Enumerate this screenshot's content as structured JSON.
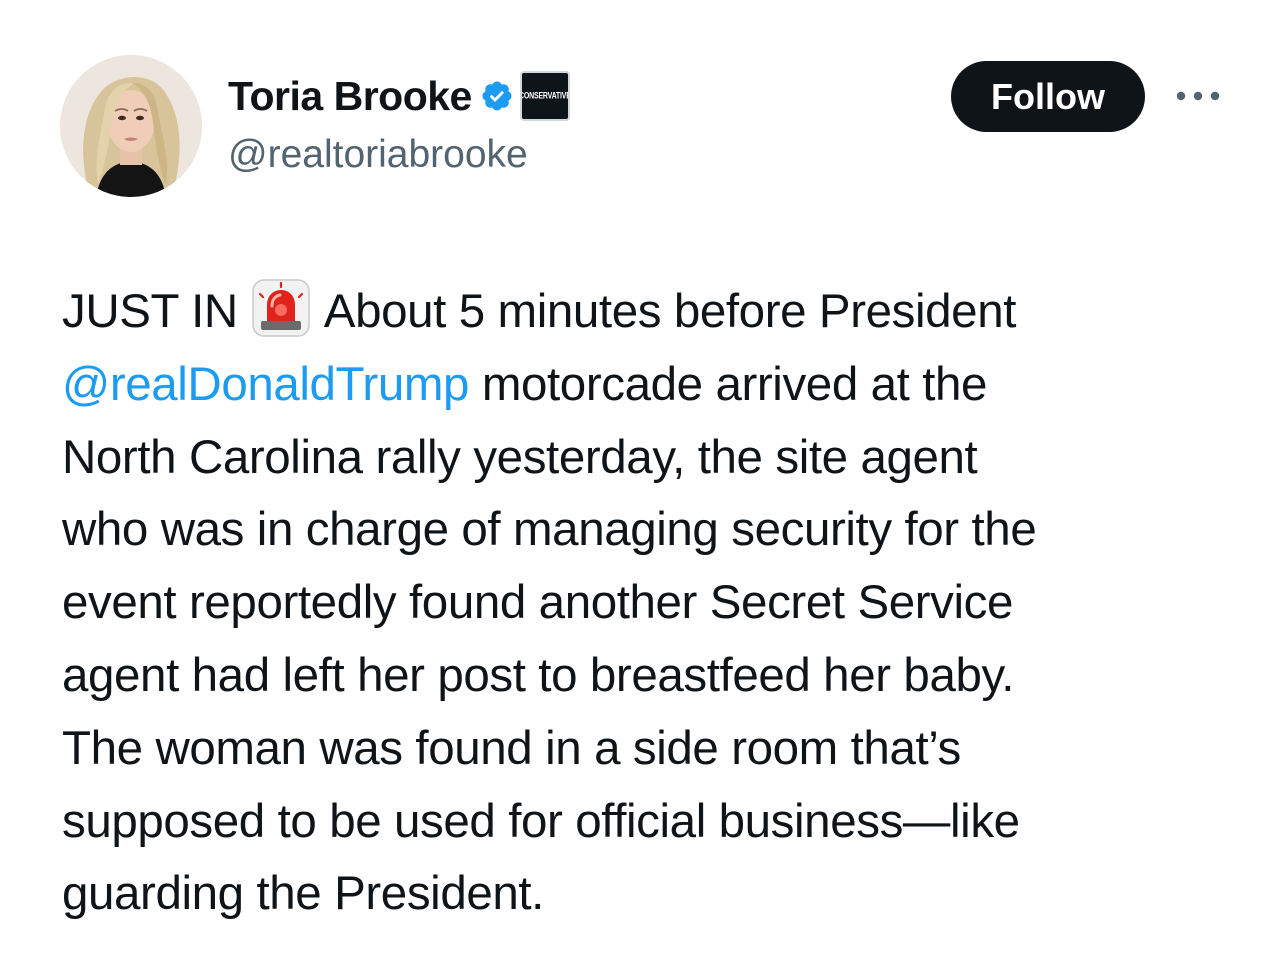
{
  "author": {
    "display_name": "Toria Brooke",
    "handle": "@realtoriabrooke",
    "verified_icon": "verified-checkmark",
    "affiliation_badge_text": "CONSERVATIVE",
    "avatar_icon": "profile-avatar"
  },
  "actions": {
    "follow_label": "Follow",
    "more_icon": "more-options-ellipsis"
  },
  "tweet": {
    "line1": {
      "pre": "JUST IN",
      "emoji": "police-siren",
      "post": "About 5 minutes before President"
    },
    "line2": {
      "mention": "@realDonaldTrump",
      "post": " motorcade arrived at the"
    },
    "line3": "North Carolina rally yesterday, the site agent",
    "line4": "who was in charge of managing security for the",
    "line5": "event reportedly found another Secret Service",
    "line6": "agent had left her post to breastfeed her baby.",
    "line7": "The woman was found in a side room that’s",
    "line8": "supposed to be used for official business—like",
    "line9": "guarding the President."
  },
  "colors": {
    "text": "#0f1419",
    "secondary_text": "#536471",
    "link": "#1d9bf0",
    "verified_blue": "#1d9bf0",
    "button_bg": "#0f1419",
    "button_text": "#ffffff"
  }
}
